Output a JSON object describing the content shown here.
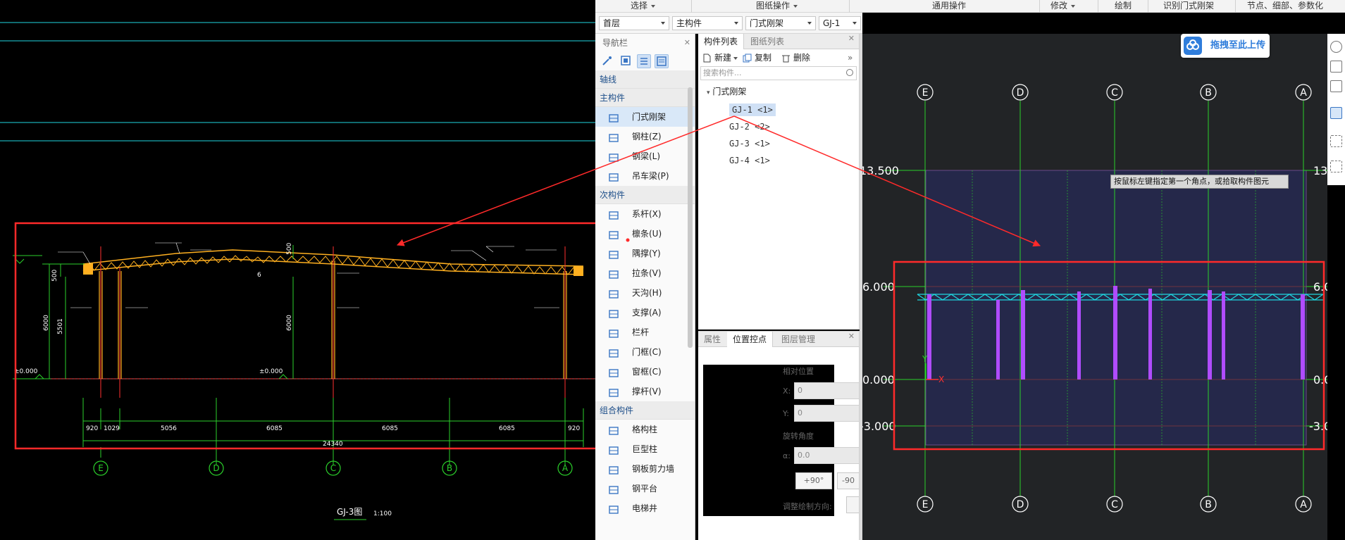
{
  "ribbon": {
    "groups": [
      {
        "label": "选择",
        "dropdown": true
      },
      {
        "label": "图纸操作",
        "dropdown": true
      },
      {
        "label": "通用操作",
        "dropdown": false
      },
      {
        "label": "修改",
        "dropdown": true
      },
      {
        "label": "绘制",
        "dropdown": false
      },
      {
        "label": "识别门式刚架",
        "dropdown": false
      },
      {
        "label": "节点、细部、参数化",
        "dropdown": false
      }
    ]
  },
  "dropdowns": {
    "floor": "首层",
    "type": "主构件",
    "category": "门式刚架",
    "component": "GJ-1"
  },
  "nav": {
    "title": "导航栏",
    "axis_label": "轴线",
    "main_label": "主构件",
    "main_items": [
      {
        "label": "门式刚架",
        "icon": "portal-frame-icon",
        "selected": true
      },
      {
        "label": "钢柱(Z)",
        "icon": "steel-column-icon"
      },
      {
        "label": "钢梁(L)",
        "icon": "steel-beam-icon"
      },
      {
        "label": "吊车梁(P)",
        "icon": "crane-beam-icon"
      }
    ],
    "secondary_label": "次构件",
    "secondary_items": [
      {
        "label": "系杆(X)",
        "icon": "tie-rod-icon"
      },
      {
        "label": "檩条(U)",
        "icon": "purlin-icon"
      },
      {
        "label": "隅撑(Y)",
        "icon": "knee-brace-icon"
      },
      {
        "label": "拉条(V)",
        "icon": "sag-rod-icon"
      },
      {
        "label": "天沟(H)",
        "icon": "gutter-icon"
      },
      {
        "label": "支撑(A)",
        "icon": "bracing-icon"
      },
      {
        "label": "栏杆",
        "icon": "railing-icon"
      },
      {
        "label": "门框(C)",
        "icon": "door-frame-icon"
      },
      {
        "label": "窗框(C)",
        "icon": "window-frame-icon"
      },
      {
        "label": "撑杆(V)",
        "icon": "strut-icon"
      }
    ],
    "combo_label": "组合构件",
    "combo_items": [
      {
        "label": "格构柱",
        "icon": "lattice-column-icon"
      },
      {
        "label": "巨型柱",
        "icon": "mega-column-icon"
      },
      {
        "label": "钢板剪力墙",
        "icon": "steel-shear-wall-icon"
      },
      {
        "label": "钢平台",
        "icon": "steel-platform-icon"
      },
      {
        "label": "电梯井",
        "icon": "elevator-shaft-icon"
      }
    ]
  },
  "components": {
    "tabs": [
      "构件列表",
      "图纸列表"
    ],
    "new_label": "新建",
    "copy_label": "复制",
    "delete_label": "删除",
    "search_placeholder": "搜索构件...",
    "tree_root": "门式刚架",
    "tree_items": [
      "GJ-1 <1>",
      "GJ-2 <2>",
      "GJ-3 <1>",
      "GJ-4 <1>"
    ]
  },
  "props": {
    "tabs": [
      "属性",
      "位置控点",
      "图层管理"
    ],
    "rel_pos_label": "相对位置",
    "x_label": "X:",
    "x_value": "0",
    "y_label": "Y:",
    "y_value": "0",
    "rot_label": "旋转角度",
    "alpha_label": "α:",
    "alpha_value": "0.0",
    "plus90": "+90°",
    "minus90": "-90",
    "adjust_label": "调整绘制方向:"
  },
  "cad": {
    "title": "GJ-3图",
    "scale": "1:100",
    "axes": [
      "E",
      "D",
      "C",
      "B",
      "A"
    ],
    "dims": [
      "920",
      "1029",
      "5056",
      "6085",
      "6085",
      "6085",
      "920"
    ],
    "total": "24340",
    "elev_left": "±0.000",
    "elev_mid": "±0.000",
    "h1": "6000",
    "h2": "5501",
    "h3": "500",
    "h4": "6000",
    "h5": "500",
    "label6": "6"
  },
  "viewport": {
    "axes_top": [
      "E",
      "D",
      "C",
      "B",
      "A"
    ],
    "axes_bottom": [
      "E",
      "D",
      "C",
      "B",
      "A"
    ],
    "levels": [
      "13.500",
      "6.000",
      "0.000",
      "-3.000"
    ],
    "upload": "拖拽至此上传",
    "tooltip": "按鼠标左键指定第一个角点，或拾取构件图元",
    "x_axis": "X",
    "y_axis": "Y"
  },
  "colors": {
    "truss": "#ffb020",
    "axis_green": "#2bd02b",
    "red_box": "#ff2a2a",
    "column_magenta": "#b04cff",
    "cyan": "#1fd6e0"
  }
}
